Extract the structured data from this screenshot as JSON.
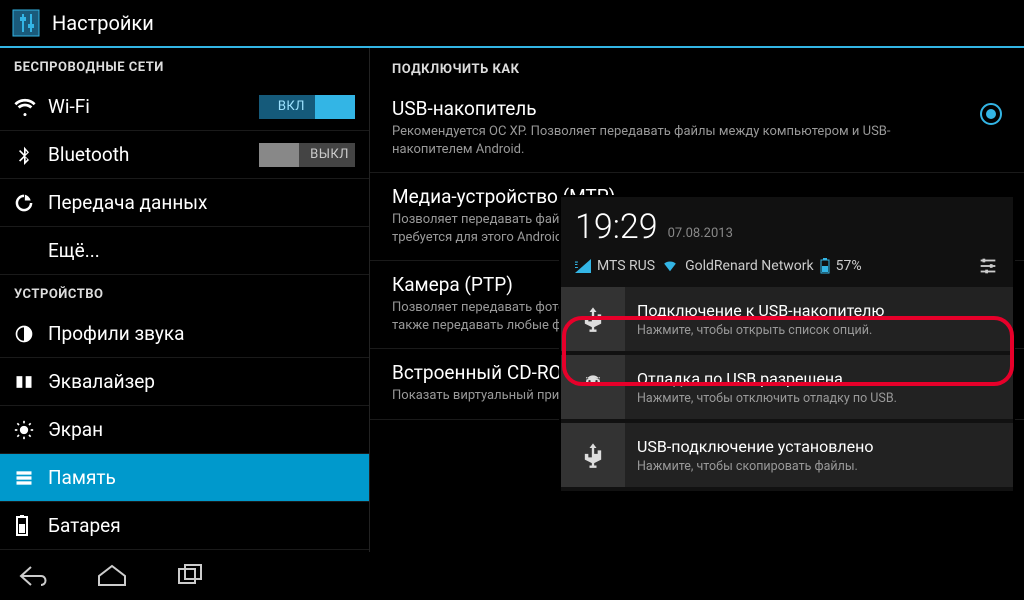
{
  "header": {
    "title": "Настройки"
  },
  "nav": {
    "cat_wireless": "БЕСПРОВОДНЫЕ СЕТИ",
    "wifi": {
      "label": "Wi‑Fi",
      "toggle": "ВКЛ",
      "on": true
    },
    "bluetooth": {
      "label": "Bluetooth",
      "toggle": "ВЫКЛ",
      "on": false
    },
    "data": {
      "label": "Передача данных"
    },
    "more": {
      "label": "Ещё..."
    },
    "cat_device": "УСТРОЙСТВО",
    "audio": {
      "label": "Профили звука"
    },
    "eq": {
      "label": "Эквалайзер"
    },
    "display": {
      "label": "Экран"
    },
    "storage": {
      "label": "Память"
    },
    "battery": {
      "label": "Батарея"
    }
  },
  "content": {
    "header": "ПОДКЛЮЧИТЬ КАК",
    "usb_storage": {
      "title": "USB-накопитель",
      "desc": "Рекомендуется ОС XP. Позволяет передавать файлы между компьютером и USB-накопителем Android.",
      "checked": true
    },
    "mtp": {
      "title": "Медиа-устройство (MTP)",
      "desc": "Позволяет передавать файлы мультимедиа в ОС Windows или Mac OS. Для Mac OS требуется для этого Android File Transfer."
    },
    "ptp": {
      "title": "Камера (PTP)",
      "desc": "Позволяет передавать фотографии с помощью программного обеспечения камеры, а также передавать любые файлы на компьютерах, которые не поддерживают MTP"
    },
    "cdrom": {
      "title": "Встроенный CD-ROM",
      "desc": "Показать виртуальный привод CD-ROM с установочным программным обеспечением."
    }
  },
  "notif": {
    "time": "19:29",
    "date": "07.08.2013",
    "carrier": "MTS RUS",
    "wifi_net": "GoldRenard Network",
    "battery": "57%",
    "card1": {
      "title": "Подключение к USB-накопителю",
      "desc": "Нажмите, чтобы открыть список опций."
    },
    "card2": {
      "title": "Отладка по USB разрешена",
      "desc": "Нажмите, чтобы отключить отладку по USB."
    },
    "card3": {
      "title": "USB-подключение установлено",
      "desc": "Нажмите, чтобы скопировать файлы."
    }
  }
}
